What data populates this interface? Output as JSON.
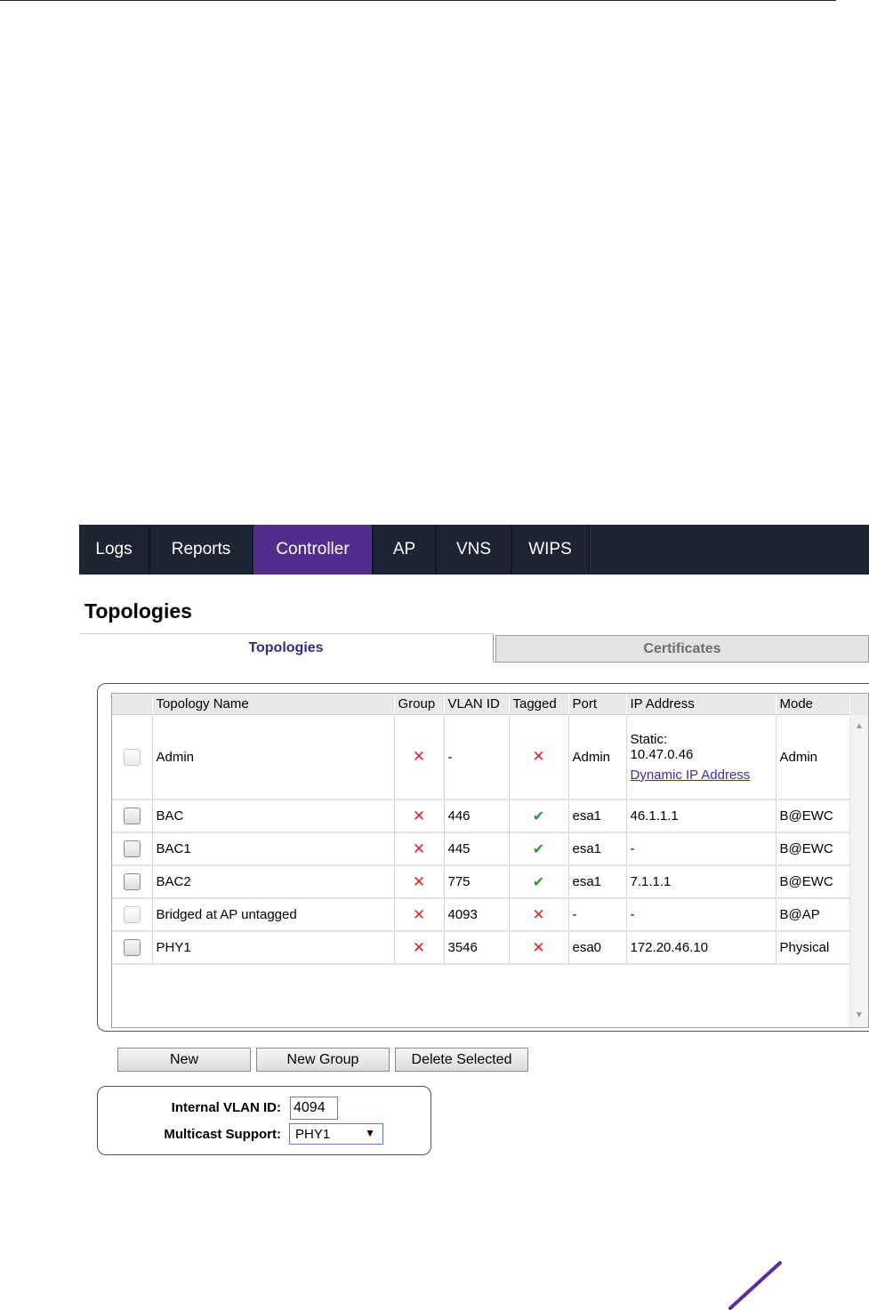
{
  "nav": {
    "tabs": [
      {
        "label": "Logs",
        "active": false
      },
      {
        "label": "Reports",
        "active": false
      },
      {
        "label": "Controller",
        "active": true
      },
      {
        "label": "AP",
        "active": false
      },
      {
        "label": "VNS",
        "active": false
      },
      {
        "label": "WIPS",
        "active": false
      }
    ]
  },
  "page": {
    "title": "Topologies"
  },
  "subtabs": {
    "topologies": "Topologies",
    "certificates": "Certificates"
  },
  "table": {
    "headers": [
      "Topology Name",
      "Group",
      "VLAN ID",
      "Tagged",
      "Port",
      "IP Address",
      "Mode"
    ],
    "rows": [
      {
        "name": "Admin",
        "group": "x-icon",
        "vlan": "-",
        "tagged": "x-icon",
        "port": "Admin",
        "ip_static_label": "Static:",
        "ip_static_value": "10.47.0.46",
        "ip_link": "Dynamic IP Address",
        "mode": "Admin",
        "checkbox_enabled": false
      },
      {
        "name": "BAC",
        "group": "x-icon",
        "vlan": "446",
        "tagged": "check-icon",
        "port": "esa1",
        "ip": "46.1.1.1",
        "mode": "B@EWC",
        "checkbox_enabled": true
      },
      {
        "name": "BAC1",
        "group": "x-icon",
        "vlan": "445",
        "tagged": "check-icon",
        "port": "esa1",
        "ip": "-",
        "mode": "B@EWC",
        "checkbox_enabled": true
      },
      {
        "name": "BAC2",
        "group": "x-icon",
        "vlan": "775",
        "tagged": "check-icon",
        "port": "esa1",
        "ip": "7.1.1.1",
        "mode": "B@EWC",
        "checkbox_enabled": true
      },
      {
        "name": "Bridged at AP untagged",
        "group": "x-icon",
        "vlan": "4093",
        "tagged": "x-icon",
        "port": "-",
        "ip": "-",
        "mode": "B@AP",
        "checkbox_enabled": false
      },
      {
        "name": "PHY1",
        "group": "x-icon",
        "vlan": "3546",
        "tagged": "x-icon",
        "port": "esa0",
        "ip": "172.20.46.10",
        "mode": "Physical",
        "checkbox_enabled": true
      }
    ]
  },
  "buttons": {
    "new": "New",
    "new_group": "New Group",
    "delete_selected": "Delete Selected"
  },
  "settings": {
    "internal_vlan_label": "Internal VLAN ID:",
    "internal_vlan_value": "4094",
    "multicast_label": "Multicast Support:",
    "multicast_value": "PHY1"
  },
  "colors": {
    "nav_bg": "#1f2434",
    "nav_active": "#512d8c",
    "x_mark": "#e0262b",
    "check_mark": "#2e9b2e",
    "link": "#3b2ea8"
  }
}
